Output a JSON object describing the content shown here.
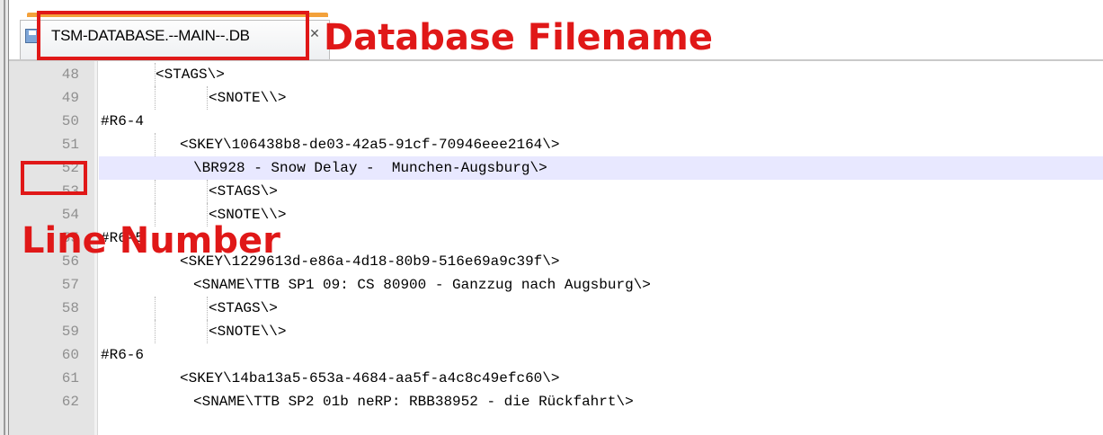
{
  "tab": {
    "filename": "TSM-DATABASE.--MAIN--.DB",
    "save_icon": "floppy-disk-icon",
    "close_icon": "close-icon"
  },
  "annotations": {
    "database_filename": "Database Filename",
    "line_number": "Line Number",
    "color": "#e01818"
  },
  "editor": {
    "current_line": "52",
    "lines": [
      {
        "num": "48",
        "text": "<STAGS\\>"
      },
      {
        "num": "49",
        "text": "<SNOTE\\\\>"
      },
      {
        "num": "50",
        "text": "#R6-4"
      },
      {
        "num": "51",
        "text": "<SKEY\\106438b8-de03-42a5-91cf-70946eee2164\\>"
      },
      {
        "num": "52",
        "text": "\\BR928 - Snow Delay -  Munchen-Augsburg\\>"
      },
      {
        "num": "53",
        "text": "<STAGS\\>"
      },
      {
        "num": "54",
        "text": "<SNOTE\\\\>"
      },
      {
        "num": "55",
        "text": "#R6-5"
      },
      {
        "num": "56",
        "text": "<SKEY\\1229613d-e86a-4d18-80b9-516e69a9c39f\\>"
      },
      {
        "num": "57",
        "text": "<SNAME\\TTB SP1 09: CS 80900 - Ganzzug nach Augsburg\\>"
      },
      {
        "num": "58",
        "text": "<STAGS\\>"
      },
      {
        "num": "59",
        "text": "<SNOTE\\\\>"
      },
      {
        "num": "60",
        "text": "#R6-6"
      },
      {
        "num": "61",
        "text": "<SKEY\\14ba13a5-653a-4684-aa5f-a4c8c49efc60\\>"
      },
      {
        "num": "62",
        "text": "<SNAME\\TTB SP2 01b neRP: RBB38952 - die Rückfahrt\\>"
      }
    ]
  }
}
